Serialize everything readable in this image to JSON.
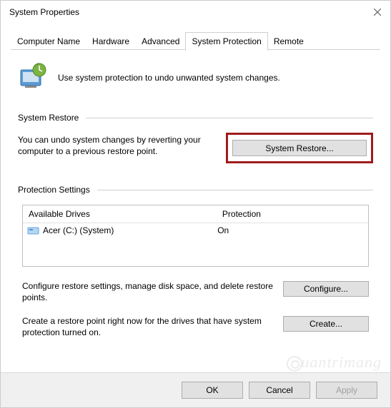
{
  "window": {
    "title": "System Properties"
  },
  "tabs": [
    {
      "label": "Computer Name"
    },
    {
      "label": "Hardware"
    },
    {
      "label": "Advanced"
    },
    {
      "label": "System Protection"
    },
    {
      "label": "Remote"
    }
  ],
  "intro": "Use system protection to undo unwanted system changes.",
  "sections": {
    "restore": {
      "title": "System Restore",
      "text": "You can undo system changes by reverting your computer to a previous restore point.",
      "button": "System Restore..."
    },
    "protection": {
      "title": "Protection Settings",
      "headers": {
        "drives": "Available Drives",
        "protection": "Protection"
      },
      "rows": [
        {
          "drive": "Acer (C:) (System)",
          "protection": "On"
        }
      ],
      "configure": {
        "text": "Configure restore settings, manage disk space, and delete restore points.",
        "button": "Configure..."
      },
      "create": {
        "text": "Create a restore point right now for the drives that have system protection turned on.",
        "button": "Create..."
      }
    }
  },
  "buttons": {
    "ok": "OK",
    "cancel": "Cancel",
    "apply": "Apply"
  },
  "watermark": "uantrimang"
}
